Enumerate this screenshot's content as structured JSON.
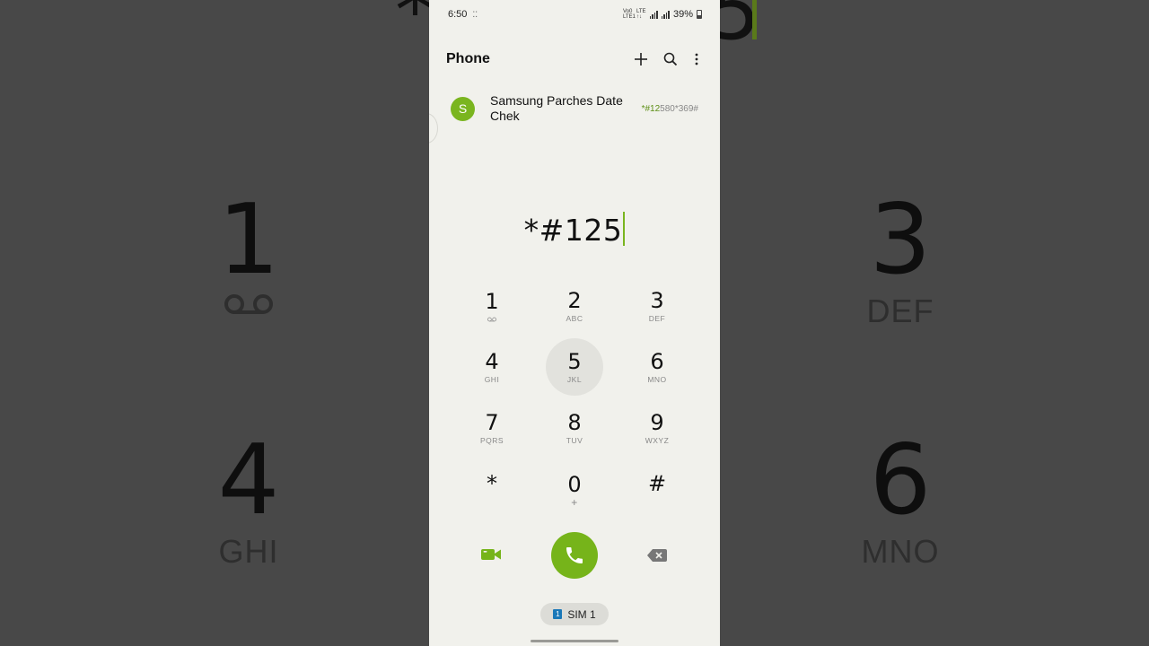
{
  "status": {
    "time": "6:50",
    "notif_glyph": "⁚⁚",
    "volte": "Vo0 LTE1",
    "lte": "LTE ↑↓",
    "battery": "39%"
  },
  "appbar": {
    "title": "Phone"
  },
  "suggestion": {
    "avatar_letter": "S",
    "name": "Samsung Parches Date Chek",
    "number_match": "*#12",
    "number_rest": "580*369#"
  },
  "dialed": {
    "value": "*#125"
  },
  "keypad": [
    {
      "digit": "1",
      "letters": ""
    },
    {
      "digit": "2",
      "letters": "ABC"
    },
    {
      "digit": "3",
      "letters": "DEF"
    },
    {
      "digit": "4",
      "letters": "GHI"
    },
    {
      "digit": "5",
      "letters": "JKL"
    },
    {
      "digit": "6",
      "letters": "MNO"
    },
    {
      "digit": "7",
      "letters": "PQRS"
    },
    {
      "digit": "8",
      "letters": "TUV"
    },
    {
      "digit": "9",
      "letters": "WXYZ"
    },
    {
      "digit": "*",
      "letters": ""
    },
    {
      "digit": "0",
      "letters": "+"
    },
    {
      "digit": "#",
      "letters": ""
    }
  ],
  "sim": {
    "badge": "1",
    "label": "SIM 1"
  },
  "background": {
    "key1_digit": "1",
    "key3_digit": "3",
    "key3_letters": "DEF",
    "key4_digit": "4",
    "key4_letters": "GHI",
    "key6_digit": "6",
    "key6_letters": "MNO"
  },
  "colors": {
    "accent": "#76b41a",
    "background": "#f1f1ec",
    "sim_badge": "#1a78b8"
  },
  "icons": {
    "add": "plus-icon",
    "search": "search-icon",
    "more": "more-vertical-icon",
    "video": "video-call-icon",
    "call": "phone-icon",
    "backspace": "backspace-icon",
    "voicemail": "voicemail-icon"
  }
}
